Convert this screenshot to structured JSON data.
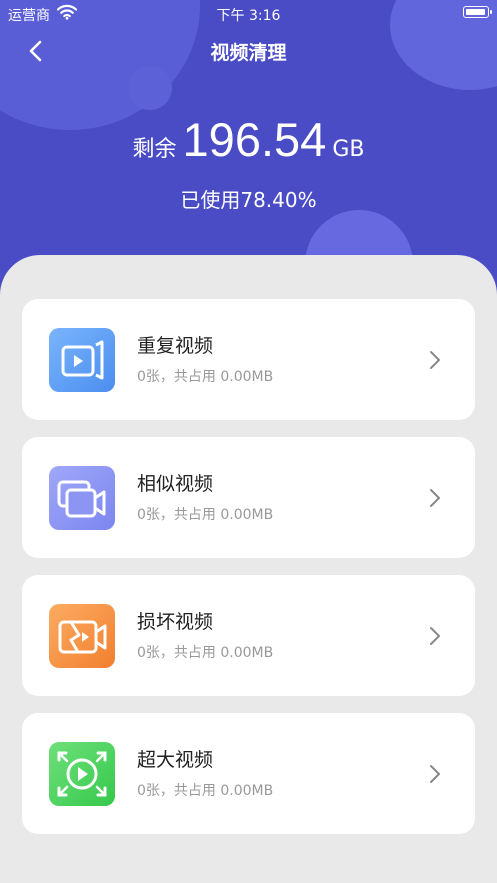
{
  "status_bar": {
    "carrier": "运营商",
    "time": "下午 3:16"
  },
  "nav": {
    "title": "视频清理"
  },
  "storage": {
    "remain_label": "剩余",
    "remain_value": "196.54",
    "remain_unit": "GB",
    "used_text": "已使用78.40%"
  },
  "colors": {
    "header_bg": "#4a4cc6",
    "card_bg": "#ffffff",
    "page_bg": "#e9e9e9"
  },
  "items": [
    {
      "label": "重复视频",
      "detail": "0张，共占用 0.00MB",
      "icon": "duplicate-video-icon",
      "color": "#4b8ef0"
    },
    {
      "label": "相似视频",
      "detail": "0张，共占用 0.00MB",
      "icon": "similar-video-icon",
      "color": "#7b86ef"
    },
    {
      "label": "损坏视频",
      "detail": "0张，共占用 0.00MB",
      "icon": "broken-video-icon",
      "color": "#f58a3a"
    },
    {
      "label": "超大视频",
      "detail": "0张，共占用 0.00MB",
      "icon": "large-video-icon",
      "color": "#3fcf55"
    }
  ]
}
